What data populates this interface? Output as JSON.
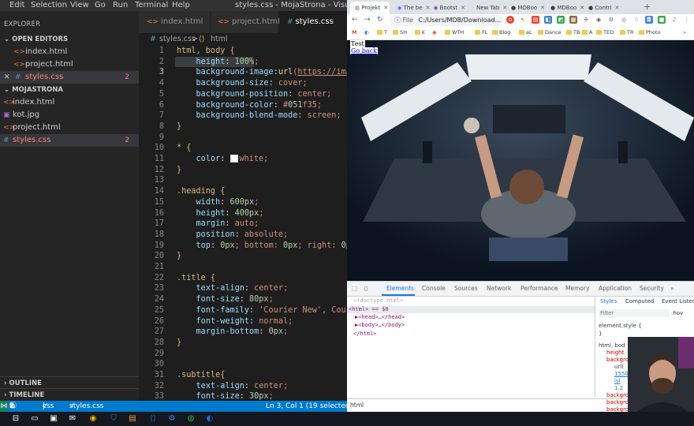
{
  "vscode": {
    "menu": [
      "Edit",
      "Selection",
      "View",
      "Go",
      "Run",
      "Terminal",
      "Help"
    ],
    "title": "styles.css - MojaStrona - Visual Studio",
    "sidebar": {
      "header": "EXPLORER",
      "open_editors_label": "OPEN EDITORS",
      "open_editors": [
        {
          "name": "index.html",
          "icon": "html-file-icon"
        },
        {
          "name": "project.html",
          "icon": "html-file-icon"
        },
        {
          "name": "styles.css",
          "icon": "css-file-icon",
          "badge": "2",
          "modified": true
        }
      ],
      "project_label": "MOJASTRONA",
      "files": [
        {
          "name": "index.html",
          "icon": "html-file-icon"
        },
        {
          "name": "kot.jpg",
          "icon": "image-file-icon"
        },
        {
          "name": "project.html",
          "icon": "html-file-icon"
        },
        {
          "name": "styles.css",
          "icon": "css-file-icon",
          "badge": "2"
        }
      ],
      "outline_label": "OUTLINE",
      "timeline_label": "TIMELINE"
    },
    "tabs": [
      {
        "label": "index.html",
        "icon": "html-file-icon",
        "active": false
      },
      {
        "label": "project.html",
        "icon": "html-file-icon",
        "active": false
      },
      {
        "label": "styles.css",
        "icon": "css-file-icon",
        "active": true
      }
    ],
    "breadcrumb": {
      "file": "styles.css",
      "sep": ">",
      "symbol": "html"
    },
    "code_lines": [
      {
        "n": "1",
        "text": "html, body {"
      },
      {
        "n": "2",
        "text": "    height: 100%;"
      },
      {
        "n": "3",
        "text": "    background-image:url(https://images"
      },
      {
        "n": "4",
        "text": "    background-size: cover;"
      },
      {
        "n": "5",
        "text": "    background-position: center;"
      },
      {
        "n": "6",
        "text": "    background-color: #051f35;"
      },
      {
        "n": "7",
        "text": "    background-blend-mode: screen;"
      },
      {
        "n": "8",
        "text": "}"
      },
      {
        "n": "9",
        "text": ""
      },
      {
        "n": "10",
        "text": "* {"
      },
      {
        "n": "11",
        "text": "    color: white;"
      },
      {
        "n": "12",
        "text": "}"
      },
      {
        "n": "13",
        "text": ""
      },
      {
        "n": "14",
        "text": ".heading {"
      },
      {
        "n": "15",
        "text": "    width: 600px;"
      },
      {
        "n": "16",
        "text": "    height: 400px;"
      },
      {
        "n": "17",
        "text": "    margin: auto;"
      },
      {
        "n": "18",
        "text": "    position: absolute;"
      },
      {
        "n": "19",
        "text": "    top: 0px; bottom: 0px; right: 0px;"
      },
      {
        "n": "20",
        "text": "}"
      },
      {
        "n": "21",
        "text": ""
      },
      {
        "n": "22",
        "text": ".title {"
      },
      {
        "n": "23",
        "text": "    text-align: center;"
      },
      {
        "n": "24",
        "text": "    font-size: 80px;"
      },
      {
        "n": "25",
        "text": "    font-family: 'Courier New', Courier"
      },
      {
        "n": "26",
        "text": "    font-weight: normal;"
      },
      {
        "n": "27",
        "text": "    margin-bottom: 0px;"
      },
      {
        "n": "28",
        "text": "}"
      },
      {
        "n": "29",
        "text": ""
      },
      {
        "n": "30",
        "text": ""
      },
      {
        "n": "31",
        "text": ".subtitle{"
      },
      {
        "n": "32",
        "text": "    text-align: center;"
      },
      {
        "n": "33",
        "text": "    font-size: 30px;"
      }
    ],
    "status": {
      "errors": "2",
      "warnings": "0",
      "info": "3",
      "lang_check": "css",
      "file_check": "styles.css",
      "cursor": "Ln 3, Col 1 (19 selected)"
    }
  },
  "chrome": {
    "tabs": [
      "Projekt",
      "The be",
      "Bootst",
      "New Tab",
      "MDBoo",
      "MDBoo",
      "Contri"
    ],
    "new_tab": "+",
    "url": "C:/Users/MDB/Download...",
    "url_prefix": "File",
    "bookmarks": [
      "T",
      "SH",
      "€",
      "WTH",
      "FL",
      "Blog",
      "aL",
      "Dance",
      "TB",
      "A",
      "TED",
      "TR",
      "Photo"
    ],
    "page": {
      "text_line": "Test",
      "link": "Go back"
    },
    "devtools": {
      "tabs": [
        "Elements",
        "Console",
        "Sources",
        "Network",
        "Performance",
        "Memory",
        "Application",
        "Security"
      ],
      "more": "»",
      "dom": [
        "<!doctype html>",
        "<html> == $0",
        "▶<head>…</head>",
        "▶<body>…</body>",
        "</html>"
      ],
      "styles_tabs": [
        "Styles",
        "Computed",
        "Event Listen"
      ],
      "filter_placeholder": "Filter",
      "hov": ":hov",
      "element_style": "element.style {",
      "element_style_close": "}",
      "rule_selector": "html, bod",
      "rule_props": [
        "height",
        "backgro",
        "url(",
        "1550",
        "isl",
        "1.2",
        "backgro",
        "backgro",
        "backgro"
      ],
      "bottom_crumb": "html"
    }
  },
  "colors": {
    "vscode_bg": "#1e1e1e",
    "status_bar": "#007acc",
    "swatch_color": "#051f35",
    "accent": "#1a73e8"
  }
}
